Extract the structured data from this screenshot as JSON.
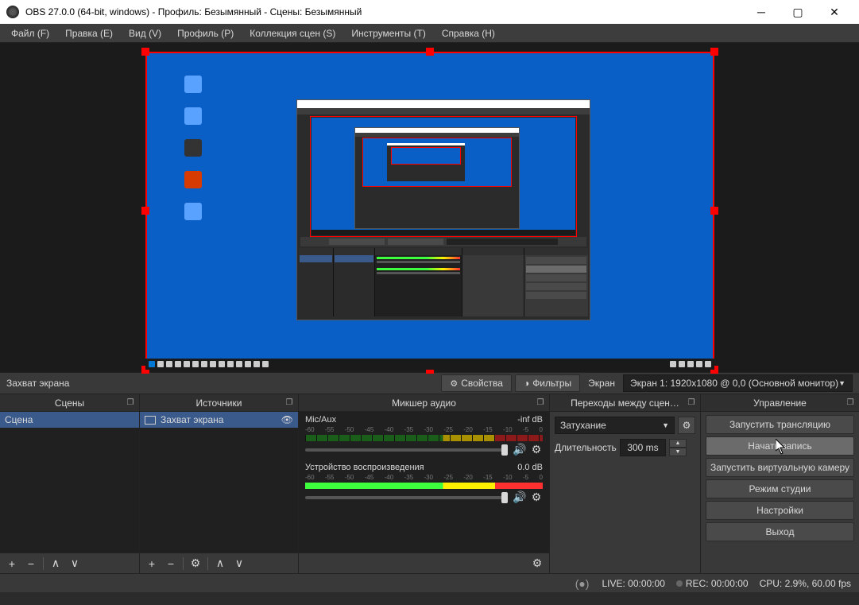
{
  "window": {
    "title": "OBS 27.0.0 (64-bit, windows) - Профиль: Безымянный - Сцены: Безымянный"
  },
  "menu": {
    "file": "Файл (F)",
    "edit": "Правка (E)",
    "view": "Вид (V)",
    "profile": "Профиль (P)",
    "sceneCollection": "Коллекция сцен (S)",
    "tools": "Инструменты (T)",
    "help": "Справка (H)"
  },
  "context": {
    "sourceName": "Захват экрана",
    "propertiesBtn": "Свойства",
    "filtersBtn": "Фильтры",
    "screenLabel": "Экран",
    "screenValue": "Экран 1: 1920x1080 @ 0,0 (Основной монитор)"
  },
  "panels": {
    "scenes": {
      "title": "Сцены",
      "items": [
        "Сцена"
      ]
    },
    "sources": {
      "title": "Источники",
      "items": [
        "Захват экрана"
      ]
    },
    "mixer": {
      "title": "Микшер аудио",
      "channels": [
        {
          "name": "Mic/Aux",
          "level": "-inf dB",
          "scale": [
            "-60",
            "-55",
            "-50",
            "-45",
            "-40",
            "-35",
            "-30",
            "-25",
            "-20",
            "-15",
            "-10",
            "-5",
            "0"
          ]
        },
        {
          "name": "Устройство воспроизведения",
          "level": "0.0 dB",
          "scale": [
            "-60",
            "-55",
            "-50",
            "-45",
            "-40",
            "-35",
            "-30",
            "-25",
            "-20",
            "-15",
            "-10",
            "-5",
            "0"
          ]
        }
      ]
    },
    "transitions": {
      "title": "Переходы между сцен…",
      "fadeLabel": "Затухание",
      "durationLabel": "Длительность",
      "durationValue": "300 ms"
    },
    "controls": {
      "title": "Управление",
      "startStream": "Запустить трансляцию",
      "startRecord": "Начать запись",
      "startVirtualCam": "Запустить виртуальную камеру",
      "studioMode": "Режим студии",
      "settings": "Настройки",
      "exit": "Выход"
    }
  },
  "status": {
    "live": "LIVE: 00:00:00",
    "rec": "REC: 00:00:00",
    "cpu": "CPU: 2.9%, 60.00 fps"
  },
  "colors": {
    "accent": "#ff0000",
    "desktop": "#0a5fc7"
  }
}
